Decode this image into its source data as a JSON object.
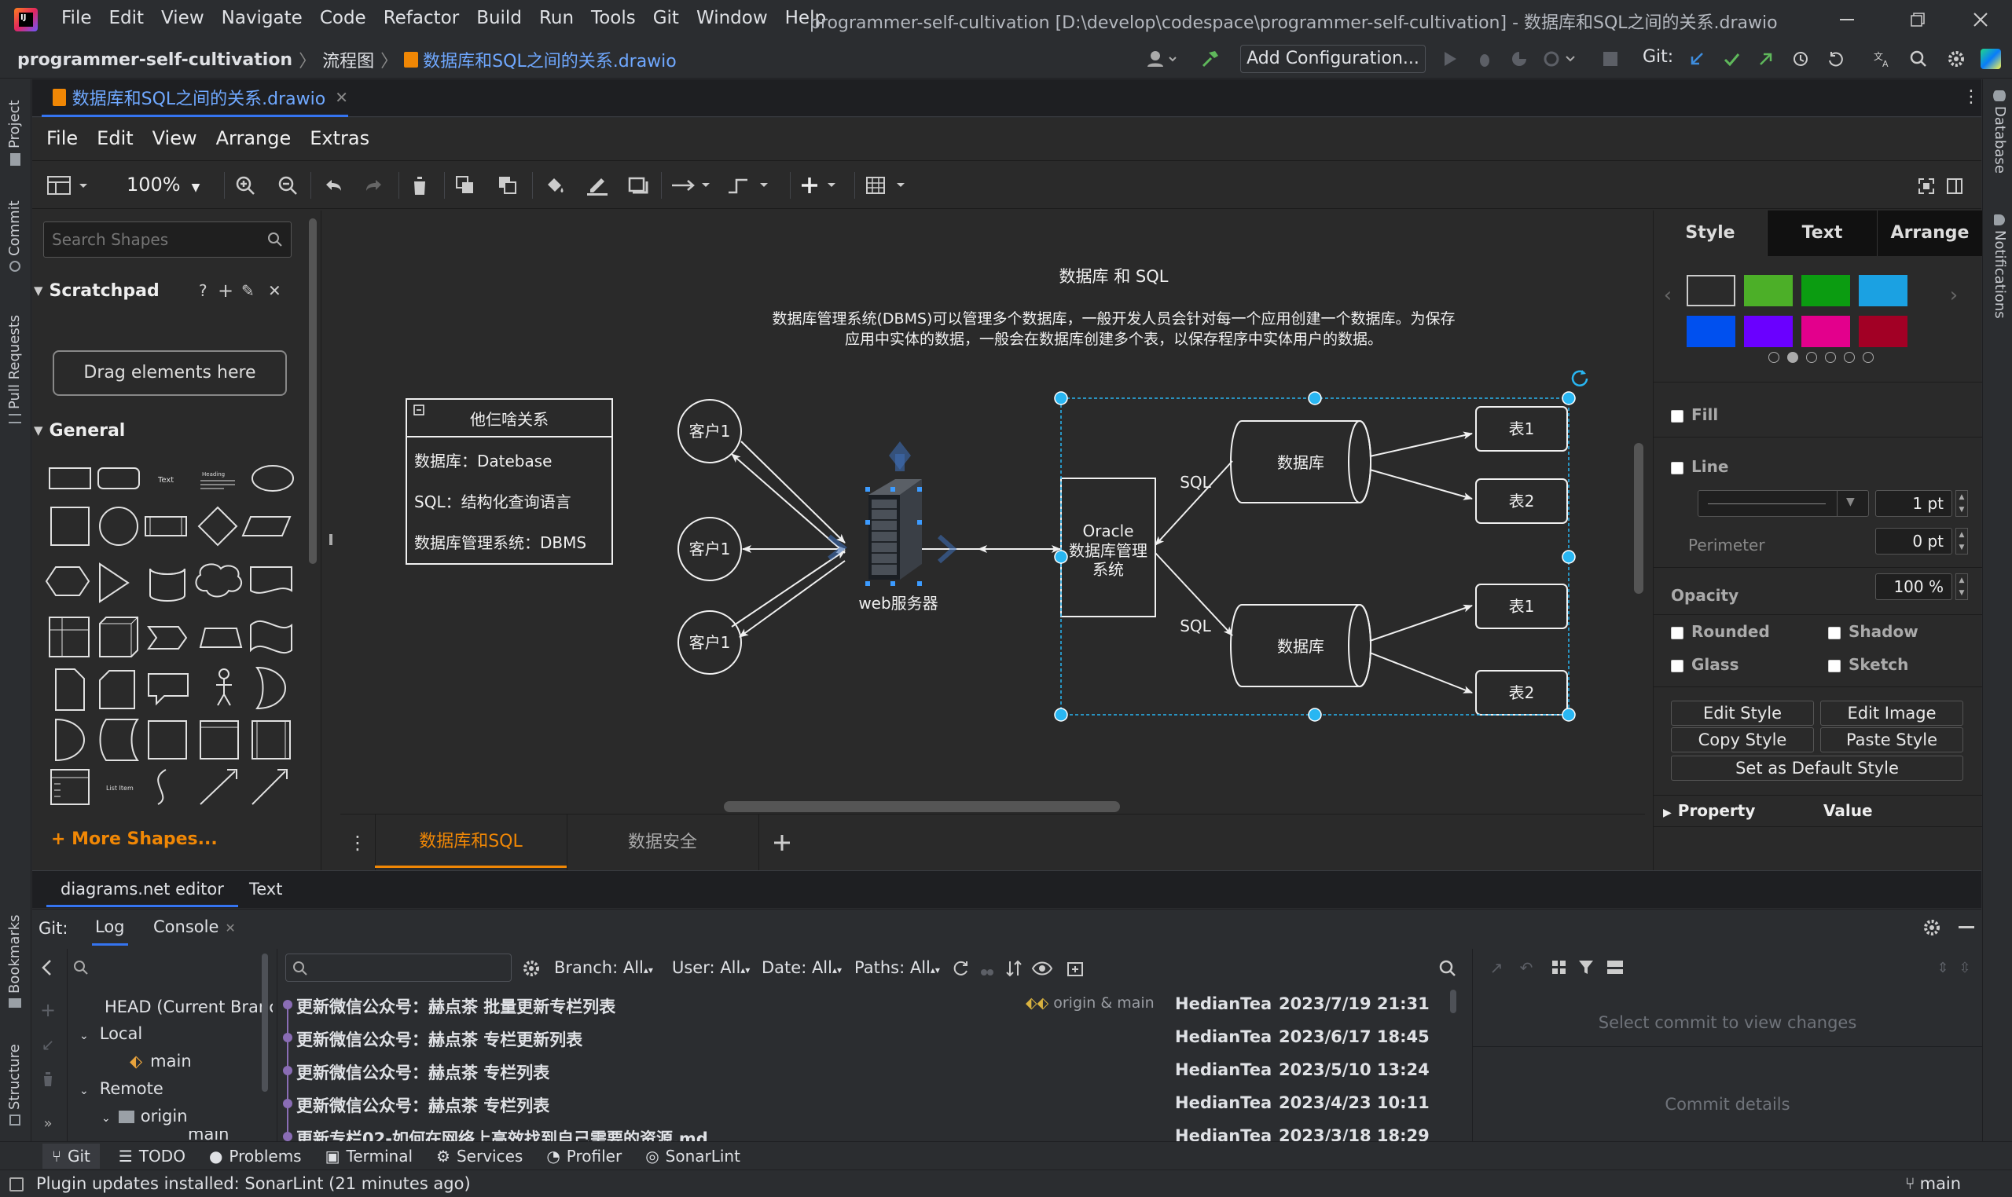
{
  "window": {
    "title": "programmer-self-cultivation [D:\\develop\\codespace\\programmer-self-cultivation] - 数据库和SQL之间的关系.drawio",
    "menu": [
      "File",
      "Edit",
      "View",
      "Navigate",
      "Code",
      "Refactor",
      "Build",
      "Run",
      "Tools",
      "Git",
      "Window",
      "Help"
    ]
  },
  "breadcrumb": {
    "project": "programmer-self-cultivation",
    "folder": "流程图",
    "file": "数据库和SQL之间的关系.drawio"
  },
  "toolbar": {
    "add_config": "Add Configuration...",
    "git_label": "Git:"
  },
  "left_stripe": {
    "project": "Project",
    "commit": "Commit",
    "pull_requests": "Pull Requests",
    "bookmarks": "Bookmarks",
    "structure": "Structure"
  },
  "right_stripe": {
    "database": "Database",
    "notifications": "Notifications"
  },
  "editor_tab": {
    "label": "数据库和SQL之间的关系.drawio"
  },
  "drawio": {
    "menu": [
      "File",
      "Edit",
      "View",
      "Arrange",
      "Extras"
    ],
    "zoom": "100%",
    "search_placeholder": "Search Shapes",
    "scratchpad": {
      "title": "Scratchpad",
      "drag_hint": "Drag elements here"
    },
    "general": "General",
    "more_shapes": "+ More Shapes...",
    "shape_labels": {
      "text": "Text",
      "heading": "Heading",
      "list_item": "List Item"
    },
    "pages": [
      {
        "label": "数据库和SQL",
        "active": true
      },
      {
        "label": "数据安全",
        "active": false
      }
    ],
    "format_tabs": [
      "Style",
      "Text",
      "Arrange"
    ],
    "swatches": [
      "#2b2b2b",
      "#4caf28",
      "#0b9c11",
      "#1ba1e2",
      "#0050ef",
      "#6a00ff",
      "#e3008c",
      "#a20025"
    ],
    "fill": "Fill",
    "line": "Line",
    "line_width": "1 pt",
    "perimeter": "Perimeter",
    "perimeter_value": "0 pt",
    "opacity": "Opacity",
    "opacity_value": "100 %",
    "checks": [
      "Rounded",
      "Shadow",
      "Glass",
      "Sketch"
    ],
    "buttons": [
      "Edit Style",
      "Edit Image",
      "Copy Style",
      "Paste Style",
      "Set as Default Style"
    ],
    "property_header": {
      "property": "Property",
      "value": "Value"
    }
  },
  "diagram": {
    "title": "数据库 和 SQL",
    "desc_line1": "数据库管理系统(DBMS)可以管理多个数据库，一般开发人员会针对每一个应用创建一个数据库。为保存",
    "desc_line2": "应用中实体的数据，一般会在数据库创建多个表，以保存程序中实体用户的数据。",
    "legend_title": "他仨啥关系",
    "legend_items": [
      "数据库：Datebase",
      "SQL：结构化查询语言",
      "数据库管理系统：DBMS"
    ],
    "client": "客户1",
    "server": "web服务器",
    "oracle_lines": [
      "Oracle",
      "数据库管理",
      "系统"
    ],
    "sql": "SQL",
    "db": "数据库",
    "table1": "表1",
    "table2": "表2"
  },
  "bottom_tabs": {
    "editor": "diagrams.net editor",
    "text": "Text"
  },
  "git_panel": {
    "git_label": "Git:",
    "tabs": [
      "Log",
      "Console"
    ],
    "filters": [
      "Branch: All",
      "User: All",
      "Date: All",
      "Paths: All"
    ],
    "tree": {
      "head": "HEAD (Current Branch)",
      "local": "Local",
      "main": "main",
      "remote": "Remote",
      "origin": "origin",
      "origin_main": "main"
    },
    "tag": "origin & main",
    "commits": [
      {
        "msg": "更新微信公众号：赫点茶 批量更新专栏列表",
        "author": "HedianTea",
        "date": "2023/7/19 21:31"
      },
      {
        "msg": "更新微信公众号：赫点茶 专栏更新列表",
        "author": "HedianTea",
        "date": "2023/6/17 18:45"
      },
      {
        "msg": "更新微信公众号：赫点茶 专栏列表",
        "author": "HedianTea",
        "date": "2023/5/10 13:24"
      },
      {
        "msg": "更新微信公众号：赫点茶 专栏列表",
        "author": "HedianTea",
        "date": "2023/4/23 10:11"
      },
      {
        "msg": "更新专栏02-如何在网络上高效找到自己需要的资源.md",
        "author": "HedianTea",
        "date": "2023/3/18 18:29"
      }
    ],
    "select_commit": "Select commit to view changes",
    "commit_details": "Commit details"
  },
  "tool_windows": [
    "Git",
    "TODO",
    "Problems",
    "Terminal",
    "Services",
    "Profiler",
    "SonarLint"
  ],
  "status": {
    "message": "Plugin updates installed: SonarLint (21 minutes ago)",
    "branch": "main"
  }
}
